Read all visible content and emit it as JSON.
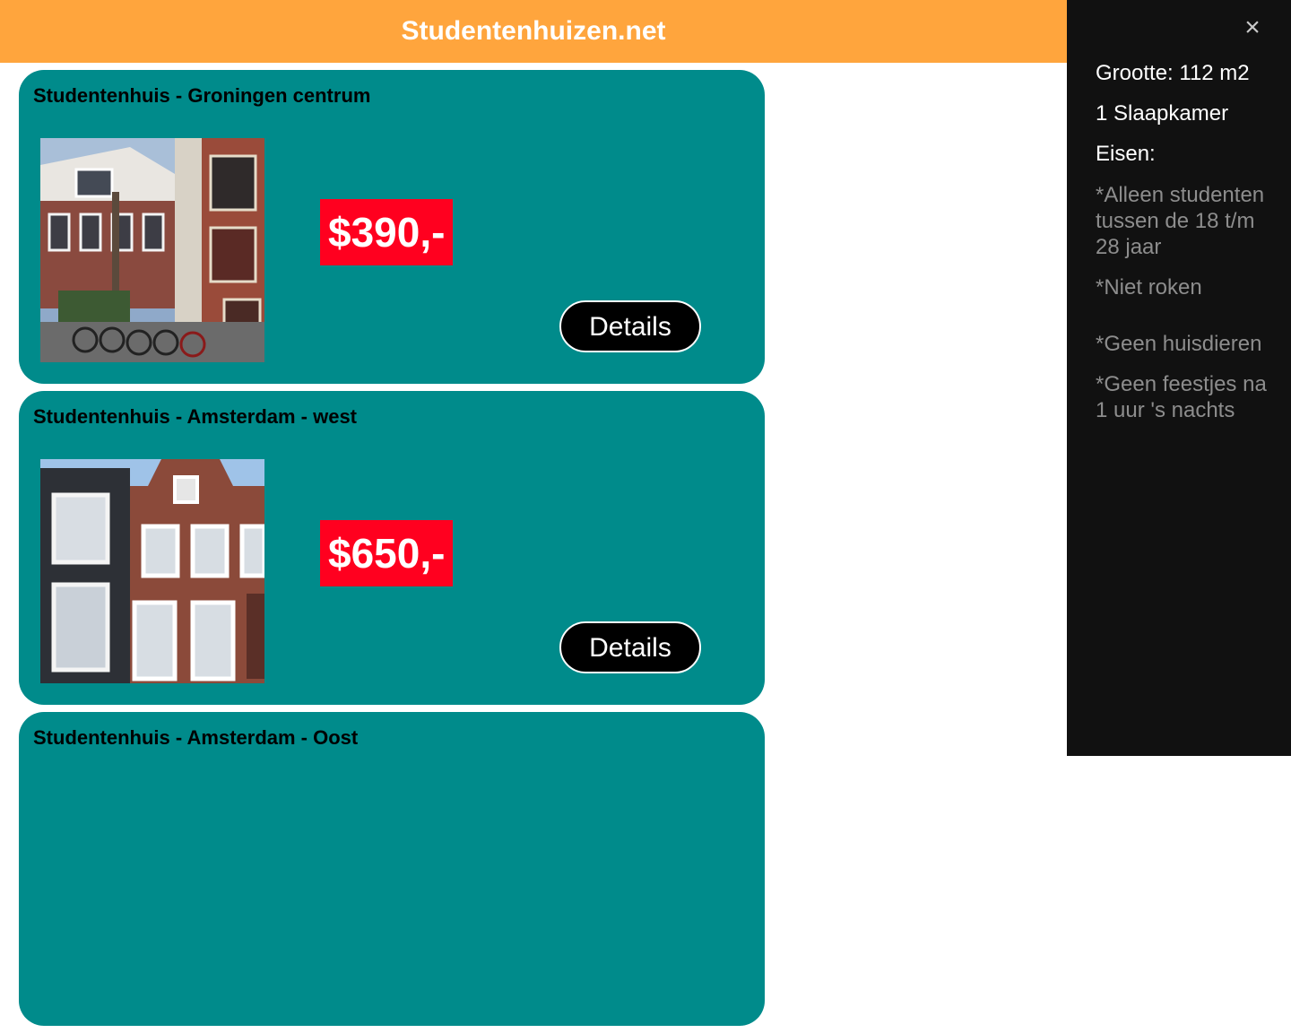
{
  "header": {
    "title": "Studentenhuizen.net"
  },
  "listings": [
    {
      "title": "Studentenhuis - Groningen centrum",
      "price": "$390,-",
      "details_label": "Details",
      "photo_icon": "townhouse-photo"
    },
    {
      "title": "Studentenhuis - Amsterdam - west",
      "price": "$650,-",
      "details_label": "Details",
      "photo_icon": "canal-house-photo"
    },
    {
      "title": "Studentenhuis - Amsterdam - Oost"
    }
  ],
  "sidepanel": {
    "close_label": "×",
    "size": "Grootte: 112 m2",
    "bedrooms": "1 Slaapkamer",
    "requirements_heading": "Eisen:",
    "requirements": [
      "*Alleen studenten tussen de 18 t/m 28 jaar",
      "*Niet roken",
      "*Geen huisdieren",
      "*Geen feestjes na 1 uur 's nachts"
    ]
  },
  "colors": {
    "header": "#ffa53d",
    "card": "#008b8b",
    "price_bg": "#ff001f",
    "panel_bg": "#111111"
  }
}
